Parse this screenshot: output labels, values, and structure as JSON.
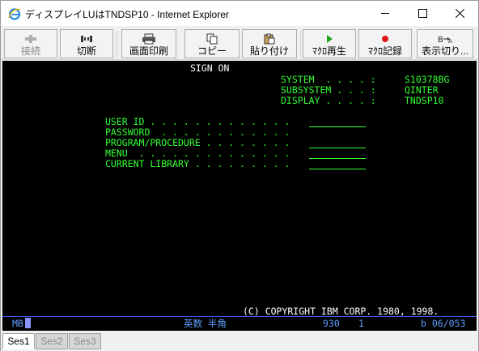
{
  "window": {
    "title": "ディスプレイLUはTNDSP10 - Internet Explorer",
    "controls": {
      "minimize": "minimize",
      "maximize": "maximize",
      "close": "close"
    }
  },
  "toolbar": {
    "buttons": [
      {
        "label": "接続",
        "icon": "connect-icon",
        "enabled": false
      },
      {
        "label": "切断",
        "icon": "disconnect-icon",
        "enabled": true
      },
      {
        "label": "画面印刷",
        "icon": "printer-icon",
        "enabled": true
      },
      {
        "label": "コピー",
        "icon": "copy-icon",
        "enabled": true
      },
      {
        "label": "貼り付け",
        "icon": "paste-icon",
        "enabled": true
      },
      {
        "label": "ﾏｸﾛ再生",
        "icon": "play-icon",
        "enabled": true
      },
      {
        "label": "ﾏｸﾛ記録",
        "icon": "record-icon",
        "enabled": true
      },
      {
        "label": "表示切り...",
        "icon": "display-toggle-icon",
        "enabled": true
      }
    ]
  },
  "terminal": {
    "heading": "SIGN ON",
    "system_info": {
      "labels": [
        "SYSTEM  . . . . :",
        "SUBSYSTEM . . . :",
        "DISPLAY . . . . :"
      ],
      "values": [
        "S10378BG",
        "QINTER",
        "TNDSP10"
      ]
    },
    "fields": [
      "USER ID . . . . . . . . . . . . .",
      "PASSWORD  . . . . . . . . . . . .",
      "PROGRAM/PROCEDURE . . . . . . . .",
      "MENU  . . . . . . . . . . . . . .",
      "CURRENT LIBRARY . . . . . . . . ."
    ],
    "copyright": "(C) COPYRIGHT IBM CORP. 1980, 1998."
  },
  "status": {
    "mode": "MB",
    "input_mode": "英数 半角",
    "code": "930",
    "number": "1",
    "position": "b 06/053"
  },
  "sessions": [
    {
      "label": "Ses1",
      "active": true
    },
    {
      "label": "Ses2",
      "active": false
    },
    {
      "label": "Ses3",
      "active": false
    }
  ],
  "colors": {
    "terminal_text": "#33ff33",
    "terminal_bg": "#000000",
    "status_text": "#5f9fff"
  }
}
